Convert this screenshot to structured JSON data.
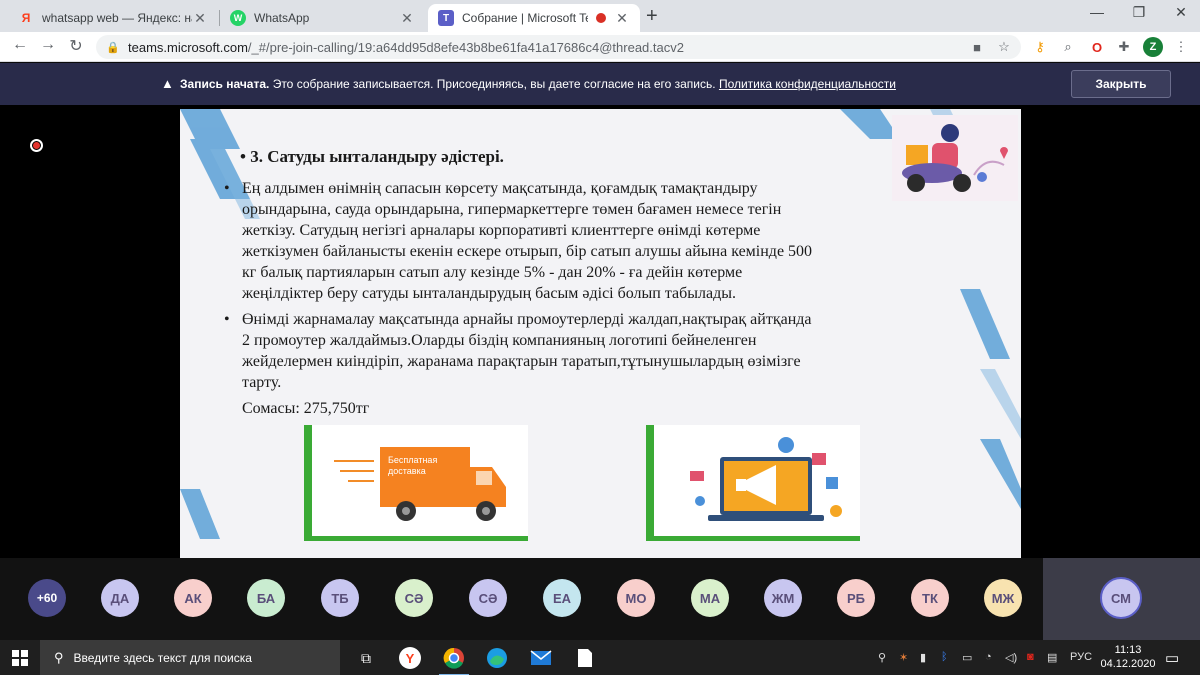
{
  "browser": {
    "tabs": [
      {
        "title": "whatsapp web — Яндекс: нашло",
        "favicon": "Я"
      },
      {
        "title": "WhatsApp",
        "favicon": "W"
      },
      {
        "title": "Собрание | Microsoft Teams",
        "favicon": "T"
      }
    ],
    "url_host": "teams.microsoft.com",
    "url_path": "/_#/pre-join-calling/19:a64dd95d8efe43b8be61fa41a17686c4@thread.tacv2",
    "profile_initial": "Z"
  },
  "banner": {
    "bold": "Запись начата.",
    "message": " Это собрание записывается. Присоединяясь, вы даете согласие на его запись. ",
    "link": "Политика конфиденциальности",
    "close_label": "Закрыть"
  },
  "slide": {
    "heading": "• 3. Сатуды ынталандыру әдістері.",
    "bullet1": "Ең алдымен өнімнің сапасын көрсету мақсатында, қоғамдық тамақтандыру\nорындарына, сауда орындарына, гипермаркеттерге төмен бағамен немесе тегін\nжеткізу. Сатудың негізгі арналары корпоративті клиенттерге өнімді көтерме\nжеткізумен байланысты екенін ескере отырып, бір сатып алушы айына кемінде 500\nкг балық партияларын сатып алу кезінде 5% - дан 20% - ға дейін көтерме\nжеңілдіктер беру сатуды ынталандырудың басым әдісі болып табылады.",
    "bullet2": "Өнімді жарнамалау мақсатында арнайы промоутерлерді жалдап,нақтырақ айтқанда\n2 промоутер жалдаймыз.Оларды біздің компанияның логотипі бейнеленген\nжейделермен киіндіріп, жаранама парақтарын таратып,тұтынушылардың өзімізге\nтарту.",
    "sum": "Сомасы: 275,750тг",
    "truck_text": "Бесплатная\nдоставка"
  },
  "participants": {
    "more": "+60",
    "list": [
      "ДА",
      "АК",
      "БА",
      "ТБ",
      "СӘ",
      "СӘ",
      "ЕА",
      "МО",
      "МА",
      "ЖМ",
      "РБ",
      "ТК",
      "МЖ"
    ],
    "self": "СМ",
    "colors": [
      "#c8c6f0",
      "#f8cfcc",
      "#c9ecd0",
      "#c8c6f0",
      "#d9f0cc",
      "#c8c6f0",
      "#c4e6ef",
      "#f8cfcc",
      "#d9f0cc",
      "#c8c6f0",
      "#f8cfcc",
      "#f8cfcc",
      "#f8e3b0"
    ]
  },
  "taskbar": {
    "search_placeholder": "Введите здесь текст для поиска",
    "lang": "РУС",
    "time": "11:13",
    "date": "04.12.2020"
  }
}
